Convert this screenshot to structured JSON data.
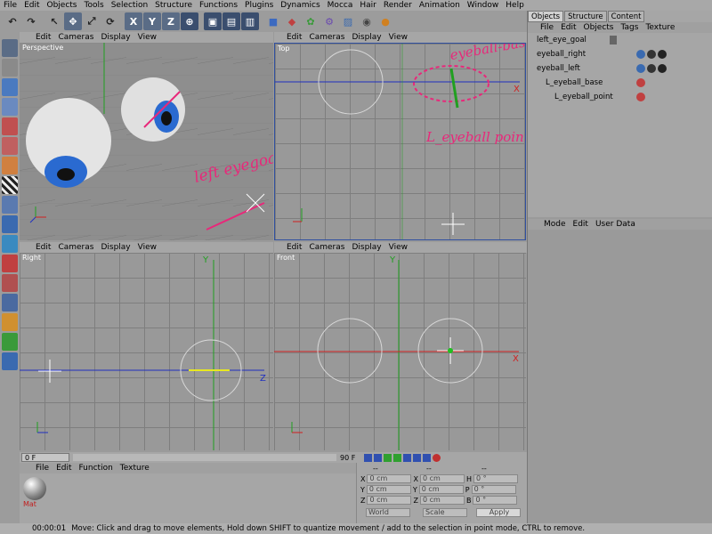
{
  "menu": [
    "File",
    "Edit",
    "Objects",
    "Tools",
    "Selection",
    "Structure",
    "Functions",
    "Plugins",
    "Dynamics",
    "Mocca",
    "Hair",
    "Render",
    "Animation",
    "Window",
    "Help"
  ],
  "viewports": {
    "menu": [
      "Edit",
      "Cameras",
      "Display",
      "View"
    ],
    "perspective_label": "Perspective",
    "top_label": "Top",
    "right_label": "Right",
    "front_label": "Front",
    "axis_x": "X",
    "axis_y": "Y",
    "axis_z": "Z"
  },
  "annotations": {
    "eyeball_base": "eyeball-base",
    "eyeball_point": "L_eyeball point",
    "left_eyegoal": "left eyegoal"
  },
  "objects_panel": {
    "tabs": [
      "Objects",
      "Structure",
      "Content"
    ],
    "menu": [
      "File",
      "Edit",
      "Objects",
      "Tags",
      "Texture"
    ],
    "items": [
      {
        "name": "left_eye_goal",
        "indent": 0
      },
      {
        "name": "eyeball_right",
        "indent": 0
      },
      {
        "name": "eyeball_left",
        "indent": 0
      },
      {
        "name": "L_eyeball_base",
        "indent": 1
      },
      {
        "name": "L_eyeball_point",
        "indent": 2
      }
    ]
  },
  "attributes_panel": {
    "menu": [
      "Mode",
      "Edit",
      "User Data"
    ]
  },
  "timeline": {
    "current_frame": "0 F",
    "end_frame": "90 F"
  },
  "material_manager": {
    "menu": [
      "File",
      "Edit",
      "Function",
      "Texture"
    ],
    "material_name": "Mat"
  },
  "coordinates": {
    "header_dashes": [
      "--",
      "--",
      "--"
    ],
    "rows": [
      {
        "a_label": "X",
        "a_val": "0 cm",
        "b_label": "X",
        "b_val": "0 cm",
        "c_label": "H",
        "c_val": "0 °"
      },
      {
        "a_label": "Y",
        "a_val": "0 cm",
        "b_label": "Y",
        "b_val": "0 cm",
        "c_label": "P",
        "c_val": "0 °"
      },
      {
        "a_label": "Z",
        "a_val": "0 cm",
        "b_label": "Z",
        "b_val": "0 cm",
        "c_label": "B",
        "c_val": "0 °"
      }
    ],
    "mode1": "World",
    "mode2": "Scale",
    "apply": "Apply"
  },
  "status": {
    "time": "00:00:01",
    "message": "Move: Click and drag to move elements, Hold down SHIFT to quantize movement / add to the selection in point mode, CTRL to remove."
  },
  "colors": {
    "annotation": "#e8287a",
    "axis_x": "#d02020",
    "axis_y": "#20a020",
    "axis_z": "#2030c0"
  }
}
